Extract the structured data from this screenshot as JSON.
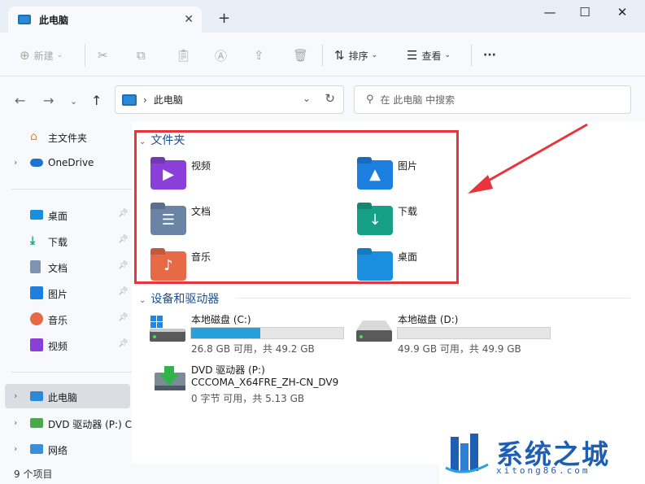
{
  "window": {
    "tab_title": "此电脑",
    "tab_close": "✕",
    "new_tab": "+",
    "minimize": "—",
    "maximize": "☐",
    "close": "✕"
  },
  "toolbar": {
    "new_label": "新建",
    "sort_label": "排序",
    "view_label": "查看",
    "more_label": "···"
  },
  "address": {
    "current": "此电脑",
    "search_placeholder": "在 此电脑 中搜索"
  },
  "sidebar": {
    "items": [
      {
        "label": "主文件夹",
        "icon": "home-icon"
      },
      {
        "label": "OneDrive",
        "icon": "cloud-icon"
      },
      {
        "label": "桌面",
        "icon": "desktop-icon"
      },
      {
        "label": "下载",
        "icon": "download-icon"
      },
      {
        "label": "文档",
        "icon": "document-icon"
      },
      {
        "label": "图片",
        "icon": "picture-icon"
      },
      {
        "label": "音乐",
        "icon": "music-icon"
      },
      {
        "label": "视频",
        "icon": "video-icon"
      },
      {
        "label": "此电脑",
        "icon": "pc-icon"
      },
      {
        "label": "DVD 驱动器 (P:) C",
        "icon": "dvd-icon"
      },
      {
        "label": "网络",
        "icon": "network-icon"
      }
    ]
  },
  "folders_section": {
    "title": "文件夹",
    "items": [
      {
        "label": "视频",
        "color": "#8b3fd9",
        "icon": "video-folder-icon"
      },
      {
        "label": "图片",
        "color": "#1c7fe0",
        "icon": "picture-folder-icon"
      },
      {
        "label": "文档",
        "color": "#6b84a6",
        "icon": "document-folder-icon"
      },
      {
        "label": "下载",
        "color": "#16a085",
        "icon": "download-folder-icon"
      },
      {
        "label": "音乐",
        "color": "#e56a45",
        "icon": "music-folder-icon"
      },
      {
        "label": "桌面",
        "color": "#1a8fe0",
        "icon": "desktop-folder-icon"
      }
    ]
  },
  "drives_section": {
    "title": "设备和驱动器",
    "drives": [
      {
        "name": "本地磁盘 (C:)",
        "free": "26.8 GB 可用，共 49.2 GB",
        "used_fraction": 0.455
      },
      {
        "name": "本地磁盘 (D:)",
        "free": "49.9 GB 可用，共 49.9 GB",
        "used_fraction": 0.0
      },
      {
        "name": "DVD 驱动器 (P:)",
        "label": "CCCOMA_X64FRE_ZH-CN_DV9",
        "free": "0 字节 可用，共 5.13 GB"
      }
    ]
  },
  "status": {
    "item_count": "9 个项目"
  },
  "watermark": {
    "text": "系统之城",
    "url": "xitong86.com"
  },
  "colors": {
    "highlight_box": "#e8353b",
    "drive_fill": "#26a0da"
  }
}
